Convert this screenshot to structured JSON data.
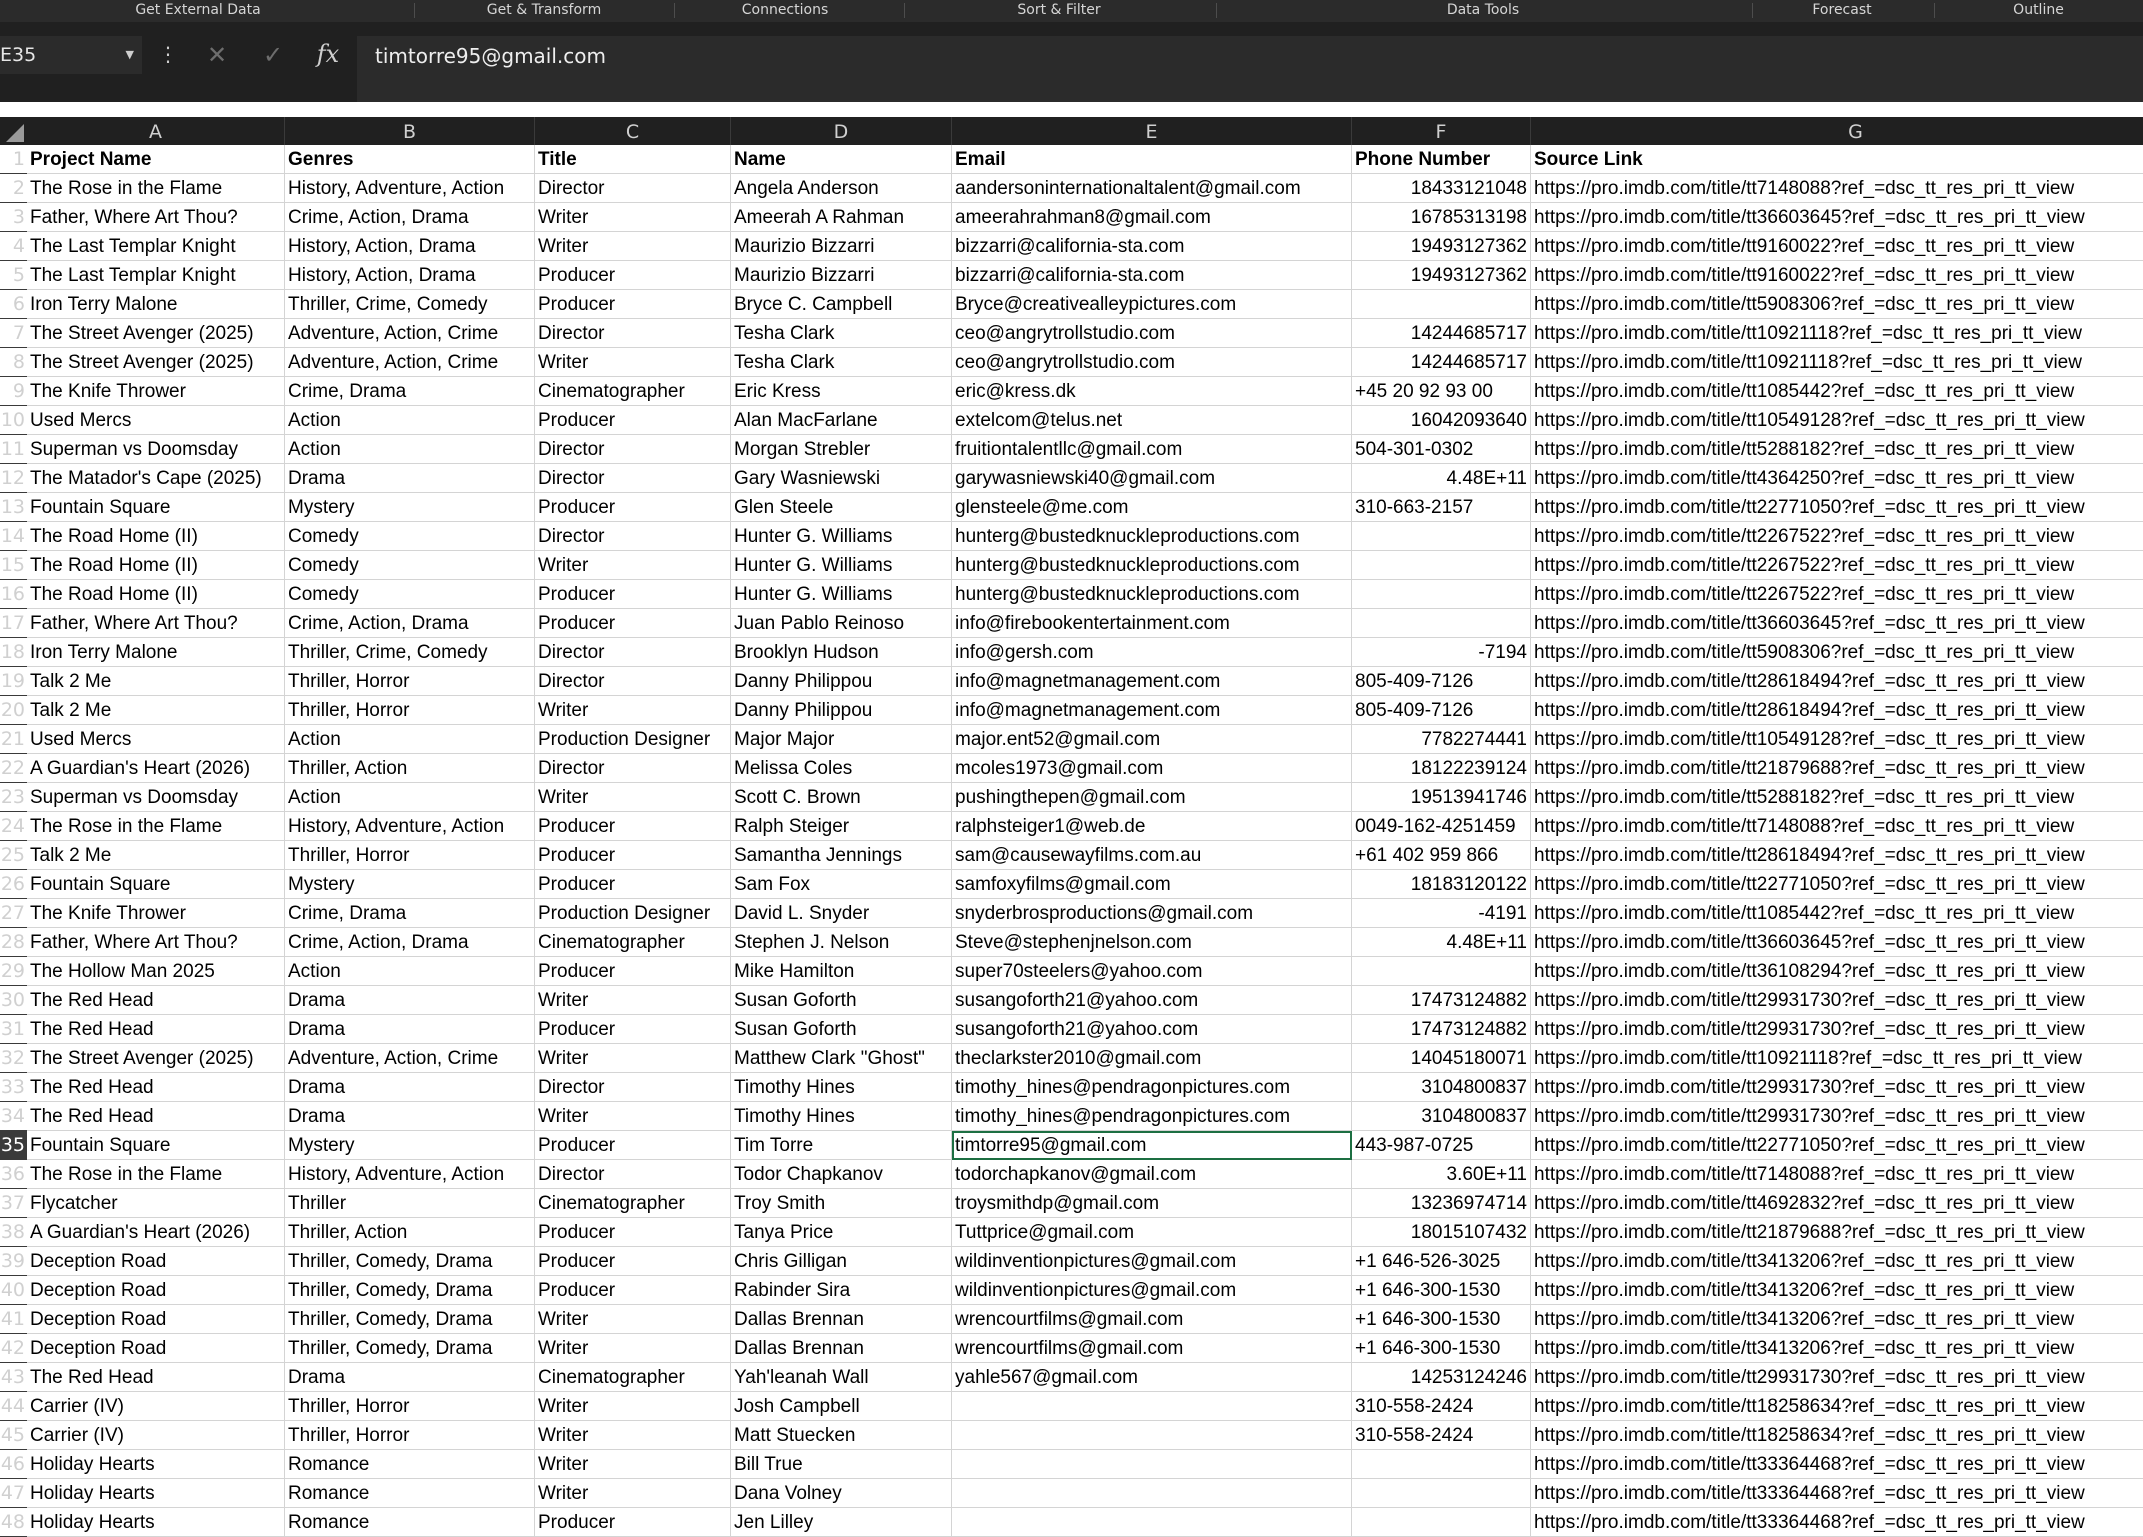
{
  "ribbon": {
    "groups": [
      "Get External Data",
      "Get & Transform",
      "Connections",
      "Sort & Filter",
      "Data Tools",
      "Forecast",
      "Outline"
    ]
  },
  "formula_bar": {
    "name_box": "E35",
    "formula": "timtorre95@gmail.com",
    "fx_icon": "fx",
    "more_icon": "⋮",
    "cancel_icon": "✕",
    "enter_icon": "✓"
  },
  "columns": [
    "A",
    "B",
    "C",
    "D",
    "E",
    "F",
    "G"
  ],
  "selected_cell": {
    "row": 35,
    "col": "E"
  },
  "rows": [
    {
      "n": "1",
      "cells": [
        "Project Name",
        "Genres",
        "Title",
        "Name",
        "Email",
        "Phone Number",
        "Source Link"
      ]
    },
    {
      "n": "2",
      "cells": [
        "The Rose in the Flame",
        "History, Adventure, Action",
        "Director",
        "Angela Anderson",
        "aandersoninternationaltalent@gmail.com",
        "18433121048",
        "https://pro.imdb.com/title/tt7148088?ref_=dsc_tt_res_pri_tt_view"
      ]
    },
    {
      "n": "3",
      "cells": [
        "Father, Where Art Thou?",
        "Crime, Action, Drama",
        "Writer",
        "Ameerah A Rahman",
        "ameerahrahman8@gmail.com",
        "16785313198",
        "https://pro.imdb.com/title/tt36603645?ref_=dsc_tt_res_pri_tt_view"
      ]
    },
    {
      "n": "4",
      "cells": [
        "The Last Templar Knight",
        "History, Action, Drama",
        "Writer",
        "Maurizio Bizzarri",
        "bizzarri@california-sta.com",
        "19493127362",
        "https://pro.imdb.com/title/tt9160022?ref_=dsc_tt_res_pri_tt_view"
      ]
    },
    {
      "n": "5",
      "cells": [
        "The Last Templar Knight",
        "History, Action, Drama",
        "Producer",
        "Maurizio Bizzarri",
        "bizzarri@california-sta.com",
        "19493127362",
        "https://pro.imdb.com/title/tt9160022?ref_=dsc_tt_res_pri_tt_view"
      ]
    },
    {
      "n": "6",
      "cells": [
        "Iron Terry Malone",
        "Thriller, Crime, Comedy",
        "Producer",
        "Bryce C. Campbell",
        "Bryce@creativealleypictures.com",
        "",
        "https://pro.imdb.com/title/tt5908306?ref_=dsc_tt_res_pri_tt_view"
      ]
    },
    {
      "n": "7",
      "cells": [
        "The Street Avenger (2025)",
        "Adventure, Action, Crime",
        "Director",
        "Tesha Clark",
        "ceo@angrytrollstudio.com",
        "14244685717",
        "https://pro.imdb.com/title/tt10921118?ref_=dsc_tt_res_pri_tt_view"
      ]
    },
    {
      "n": "8",
      "cells": [
        "The Street Avenger (2025)",
        "Adventure, Action, Crime",
        "Writer",
        "Tesha Clark",
        "ceo@angrytrollstudio.com",
        "14244685717",
        "https://pro.imdb.com/title/tt10921118?ref_=dsc_tt_res_pri_tt_view"
      ]
    },
    {
      "n": "9",
      "cells": [
        "The Knife Thrower",
        "Crime, Drama",
        "Cinematographer",
        "Eric Kress",
        "eric@kress.dk",
        "+45 20 92 93 00",
        "https://pro.imdb.com/title/tt1085442?ref_=dsc_tt_res_pri_tt_view"
      ]
    },
    {
      "n": "10",
      "cells": [
        "Used Mercs",
        "Action",
        "Producer",
        "Alan MacFarlane",
        "extelcom@telus.net",
        "16042093640",
        "https://pro.imdb.com/title/tt10549128?ref_=dsc_tt_res_pri_tt_view"
      ]
    },
    {
      "n": "11",
      "cells": [
        "Superman vs Doomsday",
        "Action",
        "Director",
        "Morgan Strebler",
        "fruitiontalentllc@gmail.com",
        "504-301-0302",
        "https://pro.imdb.com/title/tt5288182?ref_=dsc_tt_res_pri_tt_view"
      ]
    },
    {
      "n": "12",
      "cells": [
        "The Matador's Cape (2025)",
        "Drama",
        "Director",
        "Gary Wasniewski",
        "garywasniewski40@gmail.com",
        "4.48E+11",
        "https://pro.imdb.com/title/tt4364250?ref_=dsc_tt_res_pri_tt_view"
      ]
    },
    {
      "n": "13",
      "cells": [
        "Fountain Square",
        "Mystery",
        "Producer",
        "Glen Steele",
        "glensteele@me.com",
        "310-663-2157",
        "https://pro.imdb.com/title/tt22771050?ref_=dsc_tt_res_pri_tt_view"
      ]
    },
    {
      "n": "14",
      "cells": [
        "The Road Home (II)",
        "Comedy",
        "Director",
        "Hunter G. Williams",
        "hunterg@bustedknuckleproductions.com",
        "",
        "https://pro.imdb.com/title/tt2267522?ref_=dsc_tt_res_pri_tt_view"
      ]
    },
    {
      "n": "15",
      "cells": [
        "The Road Home (II)",
        "Comedy",
        "Writer",
        "Hunter G. Williams",
        "hunterg@bustedknuckleproductions.com",
        "",
        "https://pro.imdb.com/title/tt2267522?ref_=dsc_tt_res_pri_tt_view"
      ]
    },
    {
      "n": "16",
      "cells": [
        "The Road Home (II)",
        "Comedy",
        "Producer",
        "Hunter G. Williams",
        "hunterg@bustedknuckleproductions.com",
        "",
        "https://pro.imdb.com/title/tt2267522?ref_=dsc_tt_res_pri_tt_view"
      ]
    },
    {
      "n": "17",
      "cells": [
        "Father, Where Art Thou?",
        "Crime, Action, Drama",
        "Producer",
        "Juan Pablo Reinoso",
        "info@firebookentertainment.com",
        "",
        "https://pro.imdb.com/title/tt36603645?ref_=dsc_tt_res_pri_tt_view"
      ]
    },
    {
      "n": "18",
      "cells": [
        "Iron Terry Malone",
        "Thriller, Crime, Comedy",
        "Director",
        "Brooklyn Hudson",
        "info@gersh.com",
        "-7194",
        "https://pro.imdb.com/title/tt5908306?ref_=dsc_tt_res_pri_tt_view"
      ]
    },
    {
      "n": "19",
      "cells": [
        "Talk 2 Me",
        "Thriller, Horror",
        "Director",
        "Danny Philippou",
        "info@magnetmanagement.com",
        "805-409-7126",
        "https://pro.imdb.com/title/tt28618494?ref_=dsc_tt_res_pri_tt_view"
      ]
    },
    {
      "n": "20",
      "cells": [
        "Talk 2 Me",
        "Thriller, Horror",
        "Writer",
        "Danny Philippou",
        "info@magnetmanagement.com",
        "805-409-7126",
        "https://pro.imdb.com/title/tt28618494?ref_=dsc_tt_res_pri_tt_view"
      ]
    },
    {
      "n": "21",
      "cells": [
        "Used Mercs",
        "Action",
        "Production Designer",
        "Major Major",
        "major.ent52@gmail.com",
        "7782274441",
        "https://pro.imdb.com/title/tt10549128?ref_=dsc_tt_res_pri_tt_view"
      ]
    },
    {
      "n": "22",
      "cells": [
        "A Guardian's Heart (2026)",
        "Thriller, Action",
        "Director",
        "Melissa Coles",
        "mcoles1973@gmail.com",
        "18122239124",
        "https://pro.imdb.com/title/tt21879688?ref_=dsc_tt_res_pri_tt_view"
      ]
    },
    {
      "n": "23",
      "cells": [
        "Superman vs Doomsday",
        "Action",
        "Writer",
        "Scott C. Brown",
        "pushingthepen@gmail.com",
        "19513941746",
        "https://pro.imdb.com/title/tt5288182?ref_=dsc_tt_res_pri_tt_view"
      ]
    },
    {
      "n": "24",
      "cells": [
        "The Rose in the Flame",
        "History, Adventure, Action",
        "Producer",
        "Ralph Steiger",
        "ralphsteiger1@web.de",
        "0049-162-4251459",
        "https://pro.imdb.com/title/tt7148088?ref_=dsc_tt_res_pri_tt_view"
      ]
    },
    {
      "n": "25",
      "cells": [
        "Talk 2 Me",
        "Thriller, Horror",
        "Producer",
        "Samantha Jennings",
        "sam@causewayfilms.com.au",
        "+61 402 959 866",
        "https://pro.imdb.com/title/tt28618494?ref_=dsc_tt_res_pri_tt_view"
      ]
    },
    {
      "n": "26",
      "cells": [
        "Fountain Square",
        "Mystery",
        "Producer",
        "Sam Fox",
        "samfoxyfilms@gmail.com",
        "18183120122",
        "https://pro.imdb.com/title/tt22771050?ref_=dsc_tt_res_pri_tt_view"
      ]
    },
    {
      "n": "27",
      "cells": [
        "The Knife Thrower",
        "Crime, Drama",
        "Production Designer",
        "David L. Snyder",
        "snyderbrosproductions@gmail.com",
        "-4191",
        "https://pro.imdb.com/title/tt1085442?ref_=dsc_tt_res_pri_tt_view"
      ]
    },
    {
      "n": "28",
      "cells": [
        "Father, Where Art Thou?",
        "Crime, Action, Drama",
        "Cinematographer",
        "Stephen J. Nelson",
        "Steve@stephenjnelson.com",
        "4.48E+11",
        "https://pro.imdb.com/title/tt36603645?ref_=dsc_tt_res_pri_tt_view"
      ]
    },
    {
      "n": "29",
      "cells": [
        "The Hollow Man 2025",
        "Action",
        "Producer",
        "Mike Hamilton",
        "super70steelers@yahoo.com",
        "",
        "https://pro.imdb.com/title/tt36108294?ref_=dsc_tt_res_pri_tt_view"
      ]
    },
    {
      "n": "30",
      "cells": [
        "The Red Head",
        "Drama",
        "Writer",
        "Susan Goforth",
        "susangoforth21@yahoo.com",
        "17473124882",
        "https://pro.imdb.com/title/tt29931730?ref_=dsc_tt_res_pri_tt_view"
      ]
    },
    {
      "n": "31",
      "cells": [
        "The Red Head",
        "Drama",
        "Producer",
        "Susan Goforth",
        "susangoforth21@yahoo.com",
        "17473124882",
        "https://pro.imdb.com/title/tt29931730?ref_=dsc_tt_res_pri_tt_view"
      ]
    },
    {
      "n": "32",
      "cells": [
        "The Street Avenger (2025)",
        "Adventure, Action, Crime",
        "Writer",
        "Matthew Clark \"Ghost\"",
        "theclarkster2010@gmail.com",
        "14045180071",
        "https://pro.imdb.com/title/tt10921118?ref_=dsc_tt_res_pri_tt_view"
      ]
    },
    {
      "n": "33",
      "cells": [
        "The Red Head",
        "Drama",
        "Director",
        "Timothy Hines",
        "timothy_hines@pendragonpictures.com",
        "3104800837",
        "https://pro.imdb.com/title/tt29931730?ref_=dsc_tt_res_pri_tt_view"
      ]
    },
    {
      "n": "34",
      "cells": [
        "The Red Head",
        "Drama",
        "Writer",
        "Timothy Hines",
        "timothy_hines@pendragonpictures.com",
        "3104800837",
        "https://pro.imdb.com/title/tt29931730?ref_=dsc_tt_res_pri_tt_view"
      ]
    },
    {
      "n": "35",
      "cells": [
        "Fountain Square",
        "Mystery",
        "Producer",
        "Tim Torre",
        "timtorre95@gmail.com",
        "443-987-0725",
        "https://pro.imdb.com/title/tt22771050?ref_=dsc_tt_res_pri_tt_view"
      ]
    },
    {
      "n": "36",
      "cells": [
        "The Rose in the Flame",
        "History, Adventure, Action",
        "Director",
        "Todor Chapkanov",
        "todorchapkanov@gmail.com",
        "3.60E+11",
        "https://pro.imdb.com/title/tt7148088?ref_=dsc_tt_res_pri_tt_view"
      ]
    },
    {
      "n": "37",
      "cells": [
        "Flycatcher",
        "Thriller",
        "Cinematographer",
        "Troy Smith",
        "troysmithdp@gmail.com",
        "13236974714",
        "https://pro.imdb.com/title/tt4692832?ref_=dsc_tt_res_pri_tt_view"
      ]
    },
    {
      "n": "38",
      "cells": [
        "A Guardian's Heart (2026)",
        "Thriller, Action",
        "Producer",
        "Tanya Price",
        "Tuttprice@gmail.com",
        "18015107432",
        "https://pro.imdb.com/title/tt21879688?ref_=dsc_tt_res_pri_tt_view"
      ]
    },
    {
      "n": "39",
      "cells": [
        "Deception Road",
        "Thriller, Comedy, Drama",
        "Producer",
        "Chris Gilligan",
        "wildinventionpictures@gmail.com",
        "+1 646-526-3025",
        "https://pro.imdb.com/title/tt3413206?ref_=dsc_tt_res_pri_tt_view"
      ]
    },
    {
      "n": "40",
      "cells": [
        "Deception Road",
        "Thriller, Comedy, Drama",
        "Producer",
        "Rabinder Sira",
        "wildinventionpictures@gmail.com",
        "+1 646-300-1530",
        "https://pro.imdb.com/title/tt3413206?ref_=dsc_tt_res_pri_tt_view"
      ]
    },
    {
      "n": "41",
      "cells": [
        "Deception Road",
        "Thriller, Comedy, Drama",
        "Writer",
        "Dallas Brennan",
        "wrencourtfilms@gmail.com",
        "+1 646-300-1530",
        "https://pro.imdb.com/title/tt3413206?ref_=dsc_tt_res_pri_tt_view"
      ]
    },
    {
      "n": "42",
      "cells": [
        "Deception Road",
        "Thriller, Comedy, Drama",
        "Writer",
        "Dallas Brennan",
        "wrencourtfilms@gmail.com",
        "+1 646-300-1530",
        "https://pro.imdb.com/title/tt3413206?ref_=dsc_tt_res_pri_tt_view"
      ]
    },
    {
      "n": "43",
      "cells": [
        "The Red Head",
        "Drama",
        "Cinematographer",
        "Yah'leanah Wall",
        "yahle567@gmail.com",
        "14253124246",
        "https://pro.imdb.com/title/tt29931730?ref_=dsc_tt_res_pri_tt_view"
      ]
    },
    {
      "n": "44",
      "cells": [
        "Carrier (IV)",
        "Thriller, Horror",
        "Writer",
        "Josh Campbell",
        "",
        "310-558-2424",
        "https://pro.imdb.com/title/tt18258634?ref_=dsc_tt_res_pri_tt_view"
      ]
    },
    {
      "n": "45",
      "cells": [
        "Carrier (IV)",
        "Thriller, Horror",
        "Writer",
        "Matt Stuecken",
        "",
        "310-558-2424",
        "https://pro.imdb.com/title/tt18258634?ref_=dsc_tt_res_pri_tt_view"
      ]
    },
    {
      "n": "46",
      "cells": [
        "Holiday Hearts",
        "Romance",
        "Writer",
        "Bill True",
        "",
        "",
        "https://pro.imdb.com/title/tt33364468?ref_=dsc_tt_res_pri_tt_view"
      ]
    },
    {
      "n": "47",
      "cells": [
        "Holiday Hearts",
        "Romance",
        "Writer",
        "Dana Volney",
        "",
        "",
        "https://pro.imdb.com/title/tt33364468?ref_=dsc_tt_res_pri_tt_view"
      ]
    },
    {
      "n": "48",
      "cells": [
        "Holiday Hearts",
        "Romance",
        "Producer",
        "Jen Lilley",
        "",
        "",
        "https://pro.imdb.com/title/tt33364468?ref_=dsc_tt_res_pri_tt_view"
      ]
    }
  ]
}
